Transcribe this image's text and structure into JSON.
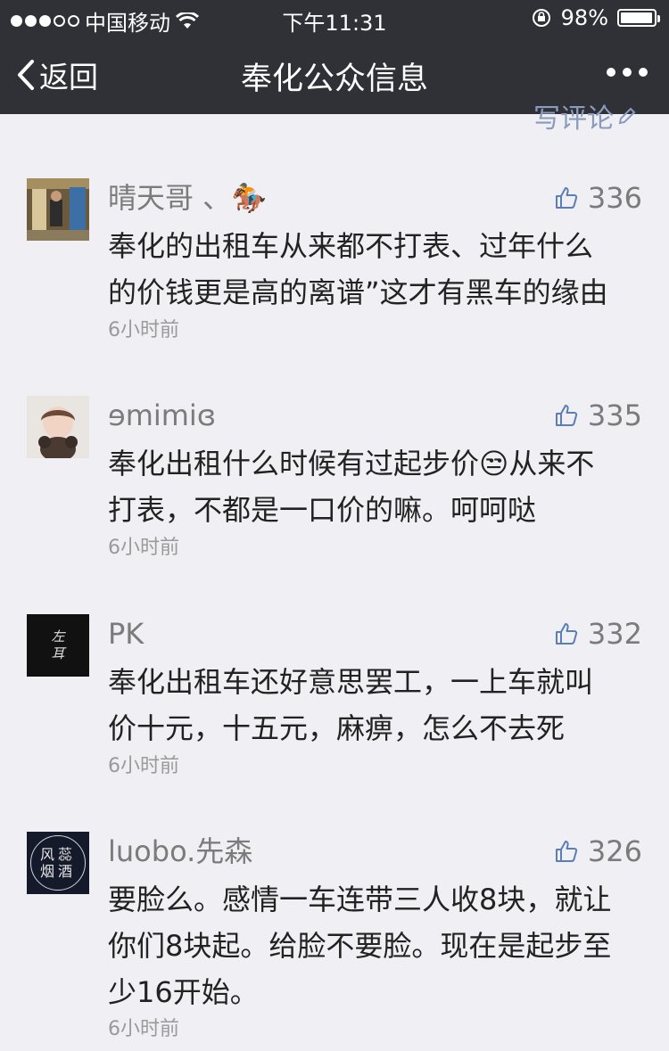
{
  "status_bar": {
    "carrier": "中国移动",
    "time": "下午11:31",
    "battery_percent_label": "98%",
    "battery_level": 0.98
  },
  "nav": {
    "back_label": "返回",
    "title": "奉化公众信息"
  },
  "write_comment_label": "写评论",
  "comments": [
    {
      "name": "晴天哥 、🏇",
      "likes": "336",
      "text": "奉化的出租车从来都不打表、过年什么\n的价钱更是高的离谱”这才有黑车的缘由",
      "time": "6小时前"
    },
    {
      "name": "ɘmimiɞ",
      "likes": "335",
      "text": "奉化出租什么时候有过起步价😒从来不\n打表，不都是一口价的嘛。呵呵哒",
      "time": "6小时前"
    },
    {
      "name": "PK",
      "likes": "332",
      "text": "奉化出租车还好意思罢工，一上车就叫\n价十元，十五元，麻痹，怎么不去死",
      "time": "6小时前",
      "avatar_text": "左耳"
    },
    {
      "name": "luobo.先森",
      "likes": "326",
      "text": "要脸么。感情一车连带三人收8块，就让\n你们8块起。给脸不要脸。现在是起步至\n少16开始。",
      "time": "6小时前",
      "avatar_text": "风蕊烟酒"
    }
  ]
}
